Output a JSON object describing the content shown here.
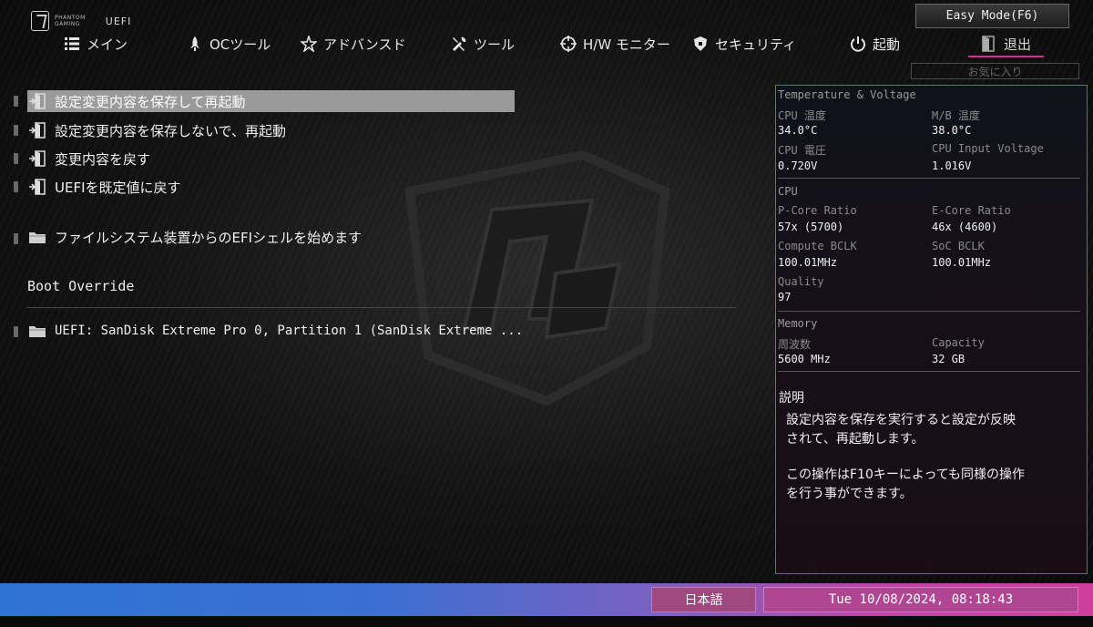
{
  "header": {
    "brand_line1": "PHANTOM",
    "brand_line2": "GAMING",
    "brand_uefi": "UEFI",
    "easy_mode": "Easy Mode(F6)",
    "favorites": "お気に入り"
  },
  "nav": {
    "tabs": [
      {
        "label": "メイン",
        "icon": "list-icon"
      },
      {
        "label": "OCツール",
        "icon": "rocket-icon"
      },
      {
        "label": "アドバンスド",
        "icon": "star-icon"
      },
      {
        "label": "ツール",
        "icon": "tools-icon"
      },
      {
        "label": "H/W モニター",
        "icon": "crosshair-icon"
      },
      {
        "label": "セキュリティ",
        "icon": "shield-icon"
      },
      {
        "label": "起動",
        "icon": "power-icon"
      },
      {
        "label": "退出",
        "icon": "exit-door-icon"
      }
    ],
    "active_tab": "退出"
  },
  "menu": {
    "items": [
      {
        "label": "設定変更内容を保存して再起動",
        "icon": "exit-door-icon"
      },
      {
        "label": "設定変更内容を保存しないで、再起動",
        "icon": "exit-door-icon"
      },
      {
        "label": "変更内容を戻す",
        "icon": "exit-door-icon"
      },
      {
        "label": "UEFIを既定値に戻す",
        "icon": "exit-door-icon"
      },
      {
        "label": "ファイルシステム装置からのEFIシェルを始めます",
        "icon": "folder-icon"
      }
    ],
    "boot_override_title": "Boot Override",
    "boot_items": [
      {
        "label": "UEFI: SanDisk Extreme Pro 0, Partition 1 (SanDisk Extreme ...",
        "icon": "folder-icon"
      }
    ]
  },
  "panel": {
    "tv_title": "Temperature & Voltage",
    "cpu_temp_label": "CPU 温度",
    "cpu_temp": "34.0°C",
    "mb_temp_label": "M/B 温度",
    "mb_temp": "38.0°C",
    "cpu_volt_label": "CPU 電圧",
    "cpu_volt": "0.720V",
    "cpu_input_label": "CPU Input Voltage",
    "cpu_input": "1.016V",
    "cpu_title": "CPU",
    "pcore_label": "P-Core Ratio",
    "pcore": "57x (5700)",
    "ecore_label": "E-Core Ratio",
    "ecore": "46x (4600)",
    "compute_label": "Compute BCLK",
    "compute": "100.01MHz",
    "soc_label": "SoC BCLK",
    "soc": "100.01MHz",
    "quality_label": "Quality",
    "quality": "97",
    "mem_title": "Memory",
    "freq_label": "周波数",
    "freq": "5600 MHz",
    "cap_label": "Capacity",
    "cap": "32 GB",
    "desc_title": "説明",
    "desc_line1": "設定内容を保存を実行すると設定が反映",
    "desc_line2": "されて、再起動します。",
    "desc_line3": "この操作はF10キーによっても同様の操作",
    "desc_line4": "を行う事ができます。"
  },
  "footer": {
    "language": "日本語",
    "datetime": "Tue 10/08/2024, 08:18:43"
  },
  "colors": {
    "accent_pink": "#d0308f",
    "accent_blue": "#2f73d5",
    "selected_row": "#9a9a9a"
  }
}
